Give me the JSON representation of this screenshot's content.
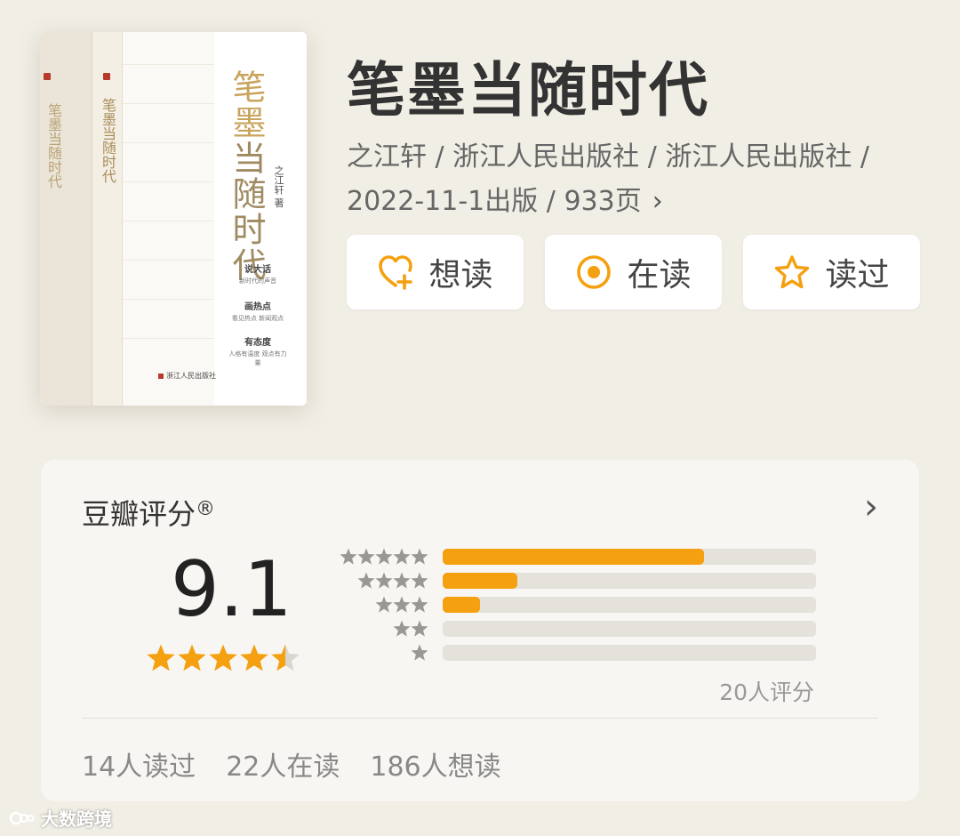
{
  "book": {
    "title": "笔墨当随时代",
    "meta_line1": "之江轩 / 浙江人民出版社 / 浙江人民出版社 /",
    "meta_line2": "2022-11-1出版 / 933页",
    "cover": {
      "title_part1": "笔墨",
      "title_part2": "当随时代",
      "author": "之江轩 著",
      "spine_title": "笔墨当随时代",
      "blurbs": [
        {
          "heading": "说大话",
          "sub": "新时代的声音"
        },
        {
          "heading": "画热点",
          "sub": "看见热点 新闻观点"
        },
        {
          "heading": "有态度",
          "sub": "人格有温度 观点有力量"
        }
      ],
      "publisher": "浙江人民出版社"
    }
  },
  "actions": {
    "want": "想读",
    "reading": "在读",
    "read": "读过"
  },
  "rating": {
    "title": "豆瓣评分",
    "reg_mark": "®",
    "score": "9.1",
    "score_stars": 4.5,
    "distribution": [
      {
        "stars": 5,
        "fraction": 0.7
      },
      {
        "stars": 4,
        "fraction": 0.2
      },
      {
        "stars": 3,
        "fraction": 0.1
      },
      {
        "stars": 2,
        "fraction": 0.0
      },
      {
        "stars": 1,
        "fraction": 0.0
      }
    ],
    "count_label": "20人评分"
  },
  "stats": {
    "read": "14人读过",
    "reading": "22人在读",
    "want": "186人想读"
  },
  "watermark": "大数跨境",
  "colors": {
    "background": "#f1eee5",
    "accent": "#f4a010",
    "card": "#f8f6f2",
    "track": "#e5e2dc"
  },
  "icons": [
    "heart-plus-icon",
    "target-icon",
    "star-outline-icon",
    "chevron-right-icon",
    "star-icon"
  ]
}
